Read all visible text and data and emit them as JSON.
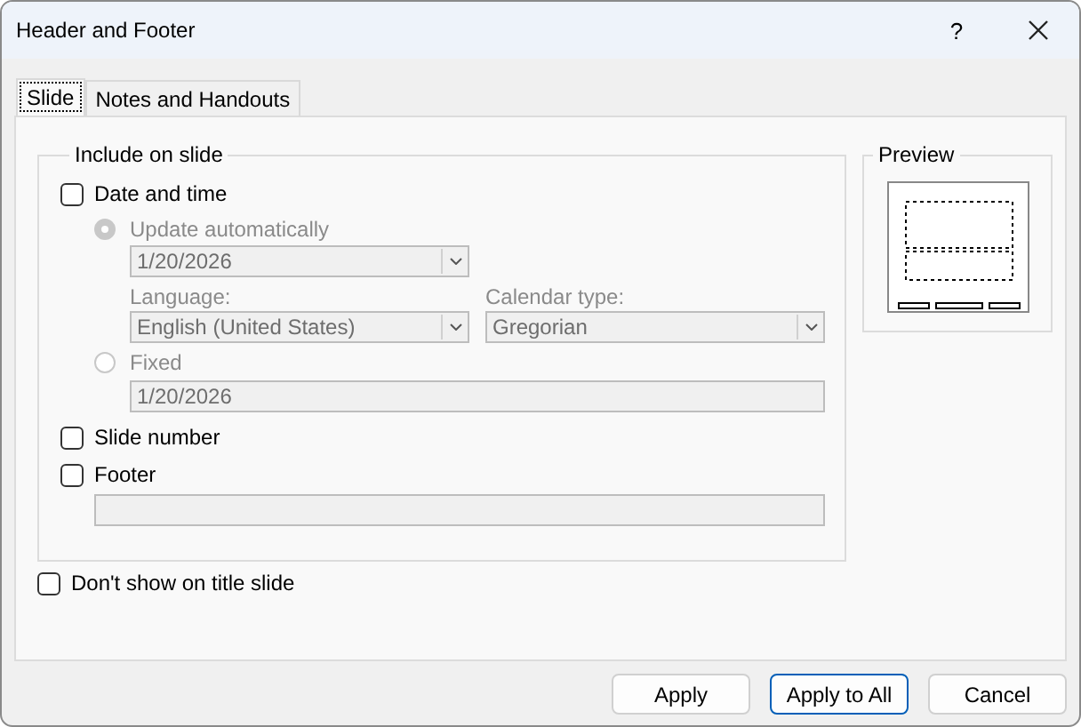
{
  "window": {
    "title": "Header and Footer",
    "help": "?"
  },
  "tabs": [
    {
      "label": "Slide",
      "selected": true
    },
    {
      "label": "Notes and Handouts",
      "selected": false
    }
  ],
  "include_group": {
    "title": "Include on slide",
    "date_time": {
      "label": "Date and time",
      "checked": false
    },
    "update_automatically": {
      "label": "Update automatically",
      "selected": true
    },
    "date_format": {
      "value": "1/20/2026"
    },
    "language": {
      "label": "Language:",
      "value": "English (United States)"
    },
    "calendar_type": {
      "label": "Calendar type:",
      "value": "Gregorian"
    },
    "fixed": {
      "label": "Fixed",
      "selected": false
    },
    "fixed_value": {
      "value": "1/20/2026"
    },
    "slide_number": {
      "label": "Slide number",
      "checked": false
    },
    "footer": {
      "label": "Footer",
      "checked": false
    }
  },
  "dont_show_on_title": {
    "label": "Don't show on title slide",
    "checked": false
  },
  "preview": {
    "title": "Preview"
  },
  "buttons": [
    {
      "label": "Apply",
      "default": false
    },
    {
      "label": "Apply to All",
      "default": true
    },
    {
      "label": "Cancel",
      "default": false
    }
  ]
}
